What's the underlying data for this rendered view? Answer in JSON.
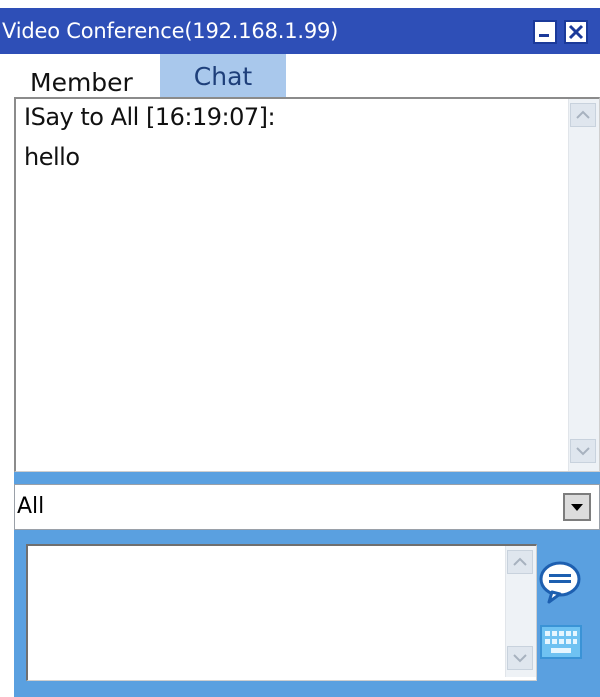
{
  "window": {
    "title": "Video Conference(192.168.1.99)",
    "minimize_icon": "minimize-icon",
    "close_icon": "close-icon"
  },
  "tabs": [
    {
      "label": "Member",
      "active": false
    },
    {
      "label": "Chat",
      "active": true
    }
  ],
  "chat": {
    "messages": [
      {
        "header": "ISay to All [16:19:07]:",
        "text": "hello"
      }
    ]
  },
  "recipient_select": {
    "value": "All"
  },
  "composer": {
    "value": "",
    "send_icon": "speech-bubble-icon",
    "keyboard_icon": "keyboard-icon"
  },
  "colors": {
    "titlebar": "#2e4fb7",
    "active_tab": "#a9c8ec",
    "panel_blue": "#5aa0e0"
  }
}
